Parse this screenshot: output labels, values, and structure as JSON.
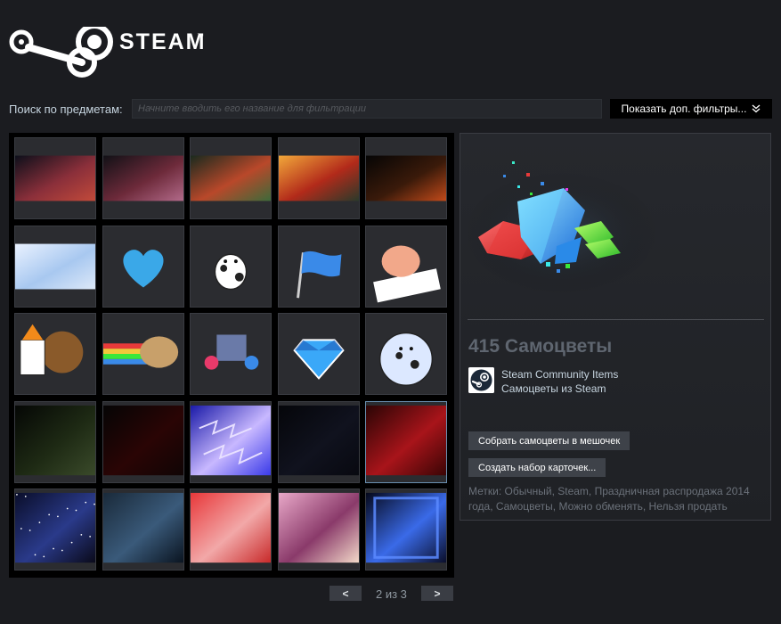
{
  "header": {
    "logo_text": "STEAM",
    "logo_tm": "™"
  },
  "filter": {
    "label": "Поиск по предметам:",
    "placeholder": "Начните вводить его название для фильтрации",
    "more_filters_label": "Показать доп. фильтры...",
    "more_filters_icon": "chevrons-down-icon"
  },
  "inventory": {
    "items": [
      {
        "name": "background-item-1",
        "kind": "background",
        "colors": [
          "#0c0f1a",
          "#8a2f3a",
          "#c24a3a"
        ]
      },
      {
        "name": "background-item-2",
        "kind": "background",
        "colors": [
          "#111116",
          "#6d2a3a",
          "#b26a8a"
        ]
      },
      {
        "name": "background-item-3",
        "kind": "background",
        "colors": [
          "#1a2a1e",
          "#b9482a",
          "#3d6a3a"
        ]
      },
      {
        "name": "background-item-4",
        "kind": "background",
        "colors": [
          "#f2a83a",
          "#b22a1a",
          "#2a3a2a"
        ]
      },
      {
        "name": "background-item-5",
        "kind": "background",
        "colors": [
          "#050505",
          "#3a1a0a",
          "#c24a1a"
        ]
      },
      {
        "name": "background-item-6",
        "kind": "background",
        "colors": [
          "#eaf2ff",
          "#a8c8f0",
          "#dce8f8"
        ]
      },
      {
        "name": "emoticon-heart",
        "kind": "heart",
        "colors": [
          "#3aa8e8"
        ]
      },
      {
        "name": "emoticon-cow",
        "kind": "cow",
        "colors": [
          "#ffffff",
          "#3a3a8a"
        ]
      },
      {
        "name": "emoticon-flag",
        "kind": "flag",
        "colors": [
          "#3a8ae8"
        ]
      },
      {
        "name": "emoticon-piano",
        "kind": "piano",
        "colors": [
          "#f2a88a",
          "#ffffff"
        ]
      },
      {
        "name": "emoticon-soldier",
        "kind": "soldier",
        "colors": [
          "#8a5a2a",
          "#f28a1a"
        ]
      },
      {
        "name": "emoticon-rainbow",
        "kind": "rainbow",
        "colors": [
          "#e83a3a",
          "#f2c83a",
          "#3ae83a",
          "#3a8ae8"
        ]
      },
      {
        "name": "emoticon-chat",
        "kind": "chat",
        "colors": [
          "#e83a6a",
          "#3a8ae8"
        ]
      },
      {
        "name": "emoticon-gem",
        "kind": "gem",
        "colors": [
          "#3aa8f8",
          "#1a5ab8"
        ]
      },
      {
        "name": "emoticon-cow-sleepy",
        "kind": "cow2",
        "colors": [
          "#dce8ff",
          "#3a3a8a"
        ]
      },
      {
        "name": "background-item-7",
        "kind": "background",
        "colors": [
          "#050705",
          "#1e2a14",
          "#3a4a2a"
        ]
      },
      {
        "name": "background-item-8",
        "kind": "background",
        "colors": [
          "#050505",
          "#2a0505",
          "#100505"
        ]
      },
      {
        "name": "background-item-9",
        "kind": "lightning",
        "colors": [
          "#1a1aa8",
          "#c8b8ff",
          "#3a3ae8"
        ]
      },
      {
        "name": "background-item-10",
        "kind": "background",
        "colors": [
          "#05060a",
          "#10121e",
          "#080910"
        ]
      },
      {
        "name": "background-item-11",
        "kind": "background",
        "colors": [
          "#2a0505",
          "#a8141a",
          "#3a0505"
        ]
      },
      {
        "name": "background-item-12",
        "kind": "stars",
        "colors": [
          "#0a0e2a",
          "#2a3a8a",
          "#0a0a1a"
        ]
      },
      {
        "name": "background-item-13",
        "kind": "background",
        "colors": [
          "#1a2a3a",
          "#3a5a7a",
          "#0a1420"
        ]
      },
      {
        "name": "background-item-14",
        "kind": "background",
        "colors": [
          "#e8383a",
          "#f2a8a8",
          "#c82a2a"
        ]
      },
      {
        "name": "background-item-15",
        "kind": "background",
        "colors": [
          "#e8a8c8",
          "#8a3a6a",
          "#f2d8c8"
        ]
      },
      {
        "name": "background-item-16",
        "kind": "frame",
        "colors": [
          "#05081a",
          "#3a6ae8",
          "#0a0e2a"
        ]
      }
    ],
    "selected_index": 19
  },
  "pager": {
    "prev_label": "<",
    "next_label": ">",
    "page_text": "2 из 3"
  },
  "detail": {
    "item_name": "415 Самоцветы",
    "game_name": "Steam Community Items",
    "game_icon": "steam-logo-icon",
    "item_type": "Самоцветы из Steam",
    "button_pack": "Собрать самоцветы в мешочек",
    "button_booster": "Создать набор карточек...",
    "tags": "Метки: Обычный, Steam, Праздничная распродажа 2014 года, Самоцветы, Можно обменять, Нельзя продать"
  }
}
